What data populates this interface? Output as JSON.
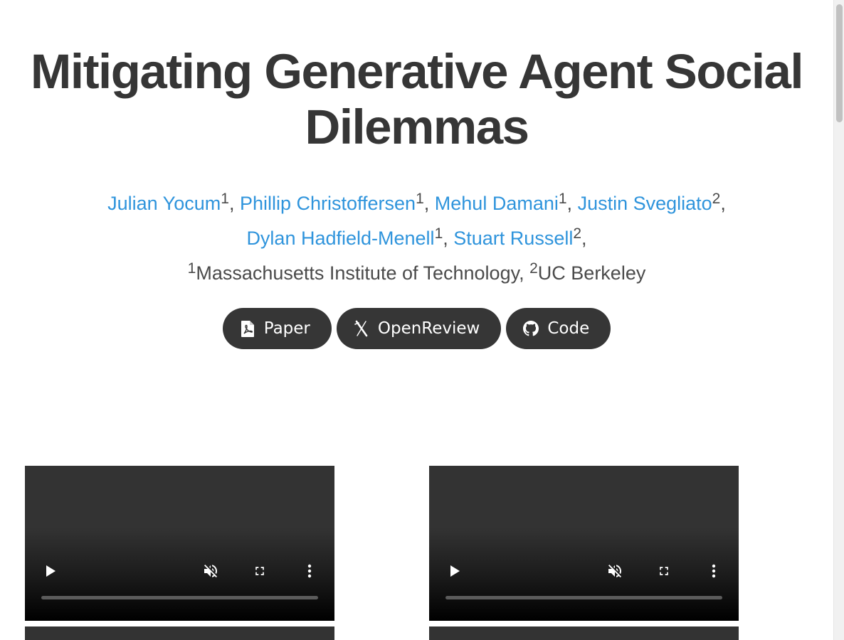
{
  "title": "Mitigating Generative Agent Social Dilemmas",
  "authors": [
    {
      "name": "Julian Yocum",
      "aff": "1",
      "sep": ", "
    },
    {
      "name": "Phillip Christoffersen",
      "aff": "1",
      "sep": ", "
    },
    {
      "name": "Mehul Damani",
      "aff": "1",
      "sep": ", "
    },
    {
      "name": "Justin Svegliato",
      "aff": "2",
      "sep": ","
    },
    {
      "name": "Dylan Hadfield-Menell",
      "aff": "1",
      "sep": ", "
    },
    {
      "name": "Stuart Russell",
      "aff": "2",
      "sep": ","
    }
  ],
  "affiliations": [
    {
      "num": "1",
      "name": "Massachusetts Institute of Technology",
      "sep": ", "
    },
    {
      "num": "2",
      "name": "UC Berkeley",
      "sep": ""
    }
  ],
  "buttons": {
    "paper": {
      "label": "Paper",
      "icon": "file-pdf-icon"
    },
    "openreview": {
      "label": "OpenReview",
      "icon": "openreview-icon"
    },
    "code": {
      "label": "Code",
      "icon": "github-icon"
    }
  },
  "colors": {
    "title": "#363636",
    "link": "#2f94dc",
    "button_bg": "#363636",
    "button_text": "#ffffff",
    "video_bg": "#333333"
  },
  "videos": [
    {
      "controls": [
        "play-icon",
        "muted-icon",
        "fullscreen-icon",
        "more-options-icon"
      ]
    },
    {
      "controls": [
        "play-icon",
        "muted-icon",
        "fullscreen-icon",
        "more-options-icon"
      ]
    }
  ]
}
